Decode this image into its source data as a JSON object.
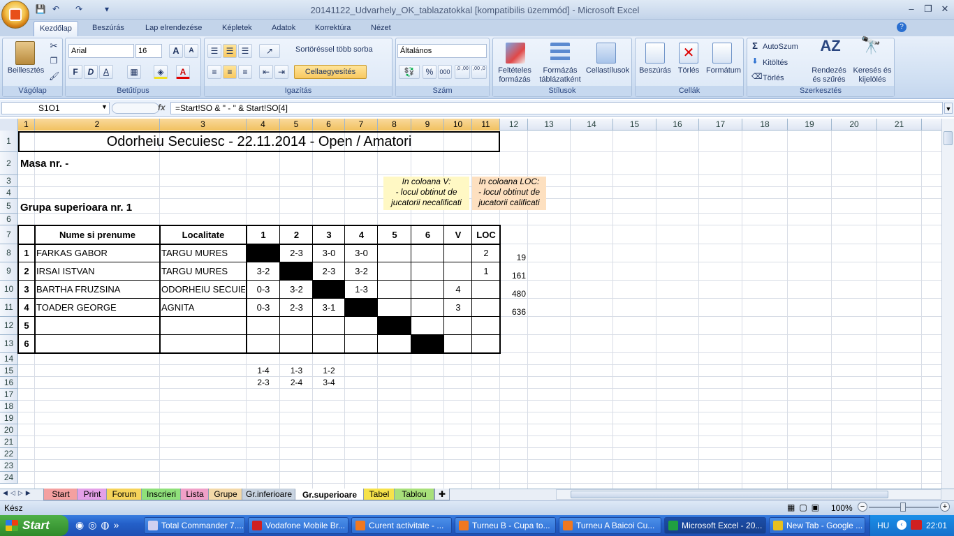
{
  "window": {
    "title": "20141122_Udvarhely_OK_tablazatokkal  [kompatibilis üzemmód] - Microsoft Excel",
    "minimize": "‒",
    "restore": "❐",
    "close": "✕"
  },
  "qat": {
    "save": "💾",
    "undo": "↶",
    "redo": "↷",
    "more": "▾"
  },
  "ribbon_tabs": [
    "Kezdőlap",
    "Beszúrás",
    "Lap elrendezése",
    "Képletek",
    "Adatok",
    "Korrektúra",
    "Nézet"
  ],
  "ribbon": {
    "clipboard": {
      "label": "Vágólap",
      "paste": "Beillesztés"
    },
    "font": {
      "label": "Betűtípus",
      "family": "Arial",
      "size": "16",
      "bold": "F",
      "italic": "D",
      "underline": "A",
      "fontcolor": "A",
      "grow": "A",
      "shrink": "A"
    },
    "alignment": {
      "label": "Igazítás",
      "wrap": "Sortöréssel több sorba",
      "merge": "Cellaegyesítés"
    },
    "number": {
      "label": "Szám",
      "format": "Általános",
      "pct": "%",
      "thou": "000",
      "dec_inc": ",0 ,00",
      "dec_dec": ",00 ,0"
    },
    "styles": {
      "label": "Stílusok",
      "cond": "Feltételes formázás",
      "table": "Formázás táblázatként",
      "cell": "Cellastílusok"
    },
    "cells": {
      "label": "Cellák",
      "insert": "Beszúrás",
      "delete": "Törlés",
      "format": "Formátum"
    },
    "editing": {
      "label": "Szerkesztés",
      "autosum": "AutoSzum",
      "fill": "Kitöltés",
      "clear": "Törlés",
      "sort": "Rendezés és szűrés",
      "find": "Keresés és kijelölés"
    }
  },
  "formula_bar": {
    "name": "S1O1",
    "fx": "fx",
    "formula": "=Start!SO & \" - \" & Start!SO[4]"
  },
  "columns": [
    "1",
    "2",
    "3",
    "4",
    "5",
    "6",
    "7",
    "8",
    "9",
    "10",
    "11",
    "12",
    "13",
    "14",
    "15",
    "16",
    "17",
    "18",
    "19",
    "20",
    "21"
  ],
  "rows": [
    "1",
    "2",
    "3",
    "4",
    "5",
    "6",
    "7",
    "8",
    "9",
    "10",
    "11",
    "12",
    "13",
    "14",
    "15",
    "16",
    "17",
    "18",
    "19",
    "20",
    "21",
    "22",
    "23",
    "24"
  ],
  "sheet": {
    "title": "Odorheiu Secuiesc - 22.11.2014 - Open / Amatori",
    "masa": "Masa nr.  -",
    "grupa": "Grupa superioara nr. 1",
    "note_v": [
      "In coloana V:",
      "- locul obtinut de",
      "jucatorii necalificati"
    ],
    "note_loc": [
      "In coloana LOC:",
      "- locul obtinut de",
      "jucatorii calificati"
    ],
    "headers": [
      "Nume si prenume",
      "Localitate",
      "1",
      "2",
      "3",
      "4",
      "5",
      "6",
      "V",
      "LOC"
    ],
    "players": [
      {
        "nr": "1",
        "name": "FARKAS GABOR",
        "loc": "TARGU MURES",
        "r": [
          "",
          "2-3",
          "3-0",
          "3-0",
          "",
          ""
        ],
        "v": "",
        "place": "2",
        "id": "19"
      },
      {
        "nr": "2",
        "name": "IRSAI ISTVAN",
        "loc": "TARGU MURES",
        "r": [
          "3-2",
          "",
          "2-3",
          "3-2",
          "",
          ""
        ],
        "v": "",
        "place": "1",
        "id": "161"
      },
      {
        "nr": "3",
        "name": "BARTHA FRUZSINA",
        "loc": "ODORHEIU SECUIE",
        "r": [
          "0-3",
          "3-2",
          "",
          "1-3",
          "",
          ""
        ],
        "v": "4",
        "place": "",
        "id": "480"
      },
      {
        "nr": "4",
        "name": "TOADER GEORGE",
        "loc": "AGNITA",
        "r": [
          "0-3",
          "2-3",
          "3-1",
          "",
          "",
          ""
        ],
        "v": "3",
        "place": "",
        "id": "636"
      },
      {
        "nr": "5",
        "name": "",
        "loc": "",
        "r": [
          "",
          "",
          "",
          "",
          "",
          ""
        ],
        "v": "",
        "place": "",
        "id": ""
      },
      {
        "nr": "6",
        "name": "",
        "loc": "",
        "r": [
          "",
          "",
          "",
          "",
          "",
          ""
        ],
        "v": "",
        "place": "",
        "id": ""
      }
    ],
    "pairs_row15": [
      "1-4",
      "1-3",
      "1-2"
    ],
    "pairs_row16": [
      "2-3",
      "2-4",
      "3-4"
    ]
  },
  "sheet_tabs": [
    {
      "label": "Start",
      "color": "#f4a0a0"
    },
    {
      "label": "Print",
      "color": "#e4a0e8"
    },
    {
      "label": "Forum",
      "color": "#f6d35a"
    },
    {
      "label": "Inscrieri",
      "color": "#8fe07a"
    },
    {
      "label": "Lista",
      "color": "#f0a0c8"
    },
    {
      "label": "Grupe",
      "color": "#f3d8a8"
    },
    {
      "label": "Gr.inferioare",
      "color": "#c8d3e0"
    },
    {
      "label": "Gr.superioare",
      "color": "#ffffff"
    },
    {
      "label": "Tabel",
      "color": "#f6e24a"
    },
    {
      "label": "Tablou",
      "color": "#a8e07a"
    }
  ],
  "status": {
    "ready": "Kész",
    "zoom": "100%"
  },
  "taskbar": {
    "start": "Start",
    "items": [
      "Total Commander 7....",
      "Vodafone Mobile Br...",
      "Curent activitate - ...",
      "Turneu B - Cupa to...",
      "Turneu A Baicoi Cu...",
      "Microsoft Excel - 20...",
      "New Tab - Google ..."
    ],
    "lang": "HU",
    "time": "22:01"
  },
  "colors": {
    "accent": "#2a4680",
    "selected_col": "#f1c15f",
    "note_yellow": "#fff8c4",
    "note_peach": "#fde0c0"
  }
}
